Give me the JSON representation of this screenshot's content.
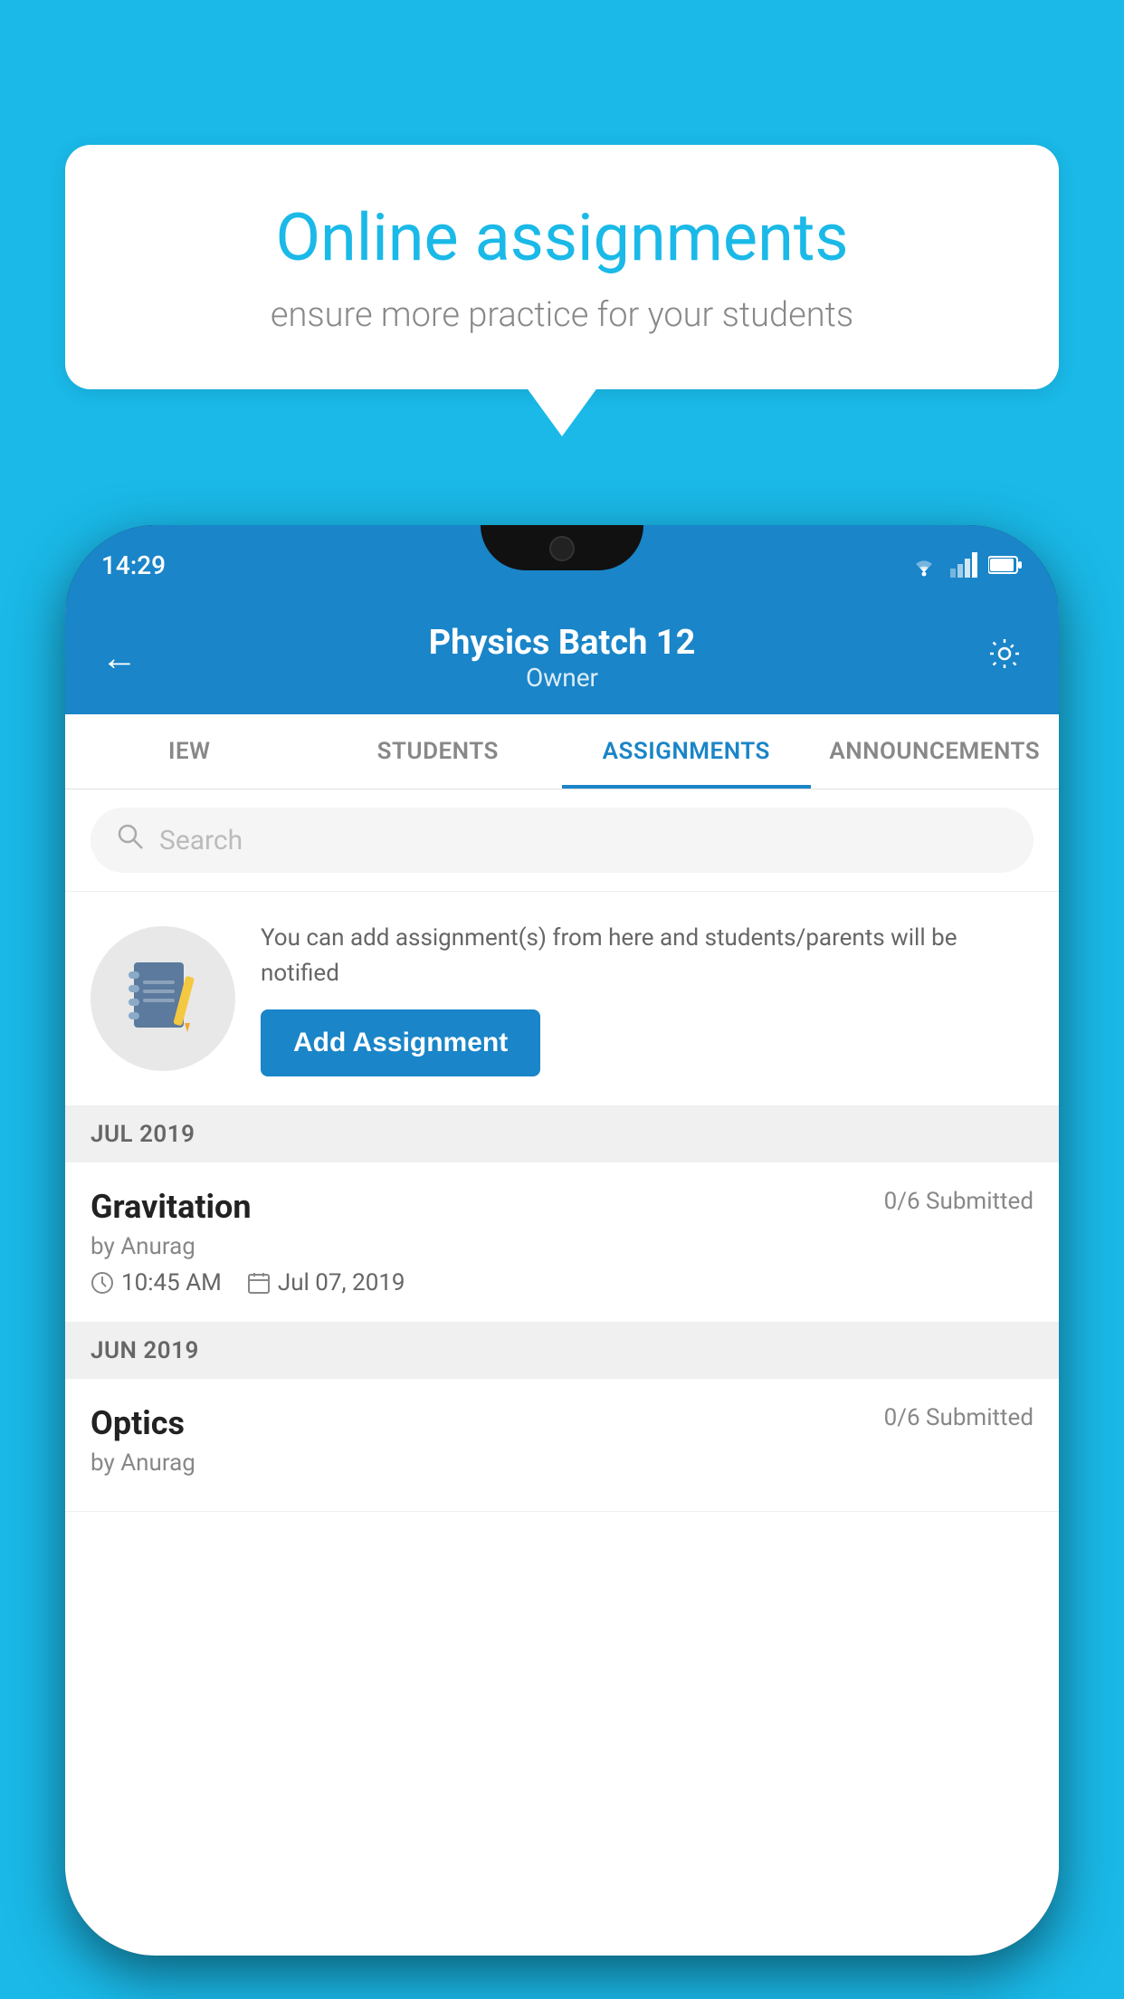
{
  "background": {
    "color": "#1ab9e8"
  },
  "speech_bubble": {
    "title": "Online assignments",
    "subtitle": "ensure more practice for your students"
  },
  "phone": {
    "status_bar": {
      "time": "14:29"
    },
    "header": {
      "title": "Physics Batch 12",
      "subtitle": "Owner",
      "back_label": "←",
      "settings_label": "⚙"
    },
    "tabs": [
      {
        "label": "IEW",
        "active": false
      },
      {
        "label": "STUDENTS",
        "active": false
      },
      {
        "label": "ASSIGNMENTS",
        "active": true
      },
      {
        "label": "ANNOUNCEMENTS",
        "active": false
      }
    ],
    "search": {
      "placeholder": "Search"
    },
    "promo": {
      "description": "You can add assignment(s) from here and students/parents will be notified",
      "button_label": "Add Assignment"
    },
    "sections": [
      {
        "month_label": "JUL 2019",
        "assignments": [
          {
            "name": "Gravitation",
            "submitted": "0/6 Submitted",
            "by": "by Anurag",
            "time": "10:45 AM",
            "date": "Jul 07, 2019"
          }
        ]
      },
      {
        "month_label": "JUN 2019",
        "assignments": [
          {
            "name": "Optics",
            "submitted": "0/6 Submitted",
            "by": "by Anurag",
            "time": "",
            "date": ""
          }
        ]
      }
    ]
  }
}
